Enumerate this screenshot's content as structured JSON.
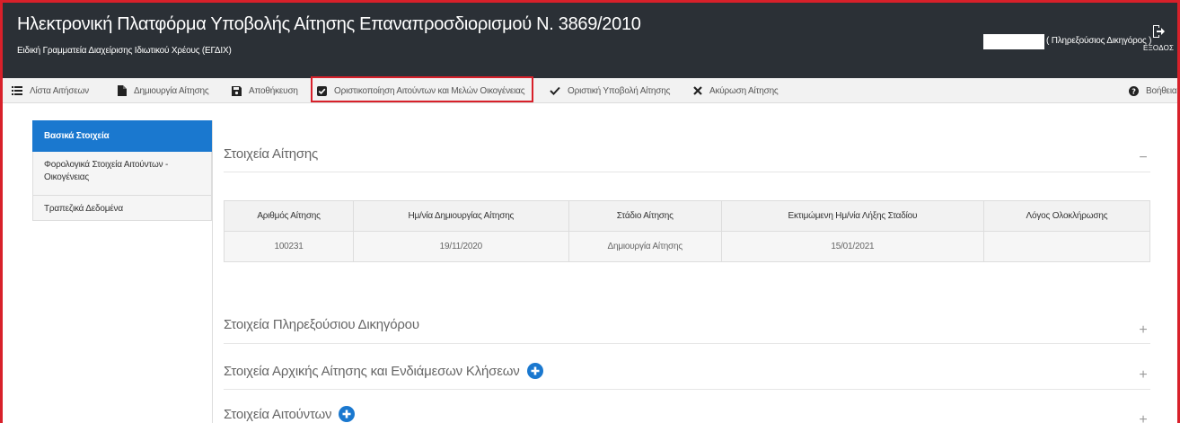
{
  "header": {
    "title": "Ηλεκτρονική Πλατφόρμα Υποβολής Αίτησης Επαναπροσδιορισμού Ν. 3869/2010",
    "subtitle": "Ειδική Γραμματεία Διαχείρισης Ιδιωτικού Χρέους (ΕΓΔΙΧ)",
    "user_role": "( Πληρεξούσιος Δικηγόρος )",
    "exit_label": "ΕΞΟΔΟΣ"
  },
  "toolbar": {
    "list": "Λίστα Αιτήσεων",
    "create": "Δημιουργία Αίτησης",
    "save": "Αποθήκευση",
    "finalize_applicants": "Οριστικοποίηση Αιτούντων και Μελών Οικογένειας",
    "final_submit": "Οριστική Υποβολή Αίτησης",
    "cancel": "Ακύρωση Αίτησης",
    "help": "Βοήθεια"
  },
  "sidenav": {
    "items": [
      {
        "label": "Βασικά Στοιχεία"
      },
      {
        "label": "Φορολογικά Στοιχεία Αιτούντων - Οικογένειας"
      },
      {
        "label": "Τραπεζικά Δεδομένα"
      }
    ]
  },
  "main": {
    "section_application": "Στοιχεία Αίτησης",
    "section_lawyer": "Στοιχεία Πληρεξούσιου Δικηγόρου",
    "section_initial": "Στοιχεία Αρχικής Αίτησης και Ενδιάμεσων Κλήσεων",
    "section_applicants": "Στοιχεία Αιτούντων",
    "collapse_symbol": "−",
    "expand_symbol": "+"
  },
  "table": {
    "headers": [
      "Αριθμός Αίτησης",
      "Ημ/νία Δημιουργίας Αίτησης",
      "Στάδιο Αίτησης",
      "Εκτιμώμενη Ημ/νία Λήξης Σταδίου",
      "Λόγος Ολοκλήρωσης"
    ],
    "row": [
      "100231",
      "19/11/2020",
      "Δημιουργία Αίτησης",
      "15/01/2021",
      ""
    ]
  },
  "colors": {
    "header_bg": "#2b3036",
    "accent_blue": "#1a78cf",
    "highlight_red": "#d8202a"
  }
}
